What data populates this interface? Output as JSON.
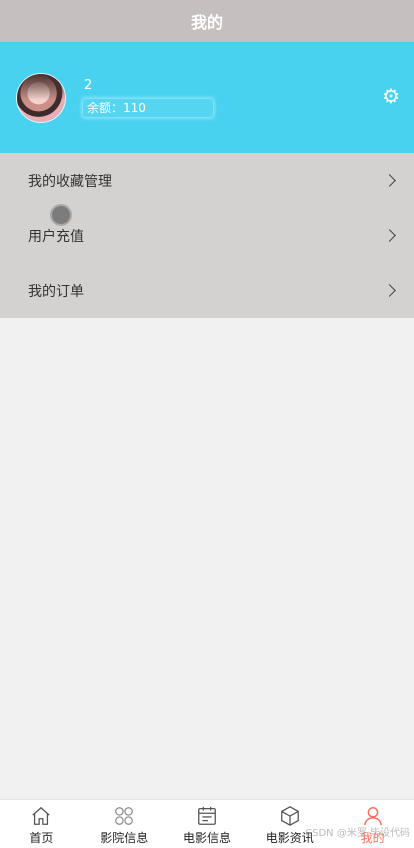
{
  "title": "我的",
  "profile": {
    "username": "2",
    "balance_label": "余额：",
    "balance_value": "110"
  },
  "icons": {
    "avatar": "user-avatar",
    "settings": "gear-icon"
  },
  "menu": [
    {
      "label": "我的收藏管理"
    },
    {
      "label": "用户充值"
    },
    {
      "label": "我的订单"
    }
  ],
  "nav": [
    {
      "label": "首页",
      "icon": "home-icon"
    },
    {
      "label": "影院信息",
      "icon": "clover-icon"
    },
    {
      "label": "电影信息",
      "icon": "calendar-icon"
    },
    {
      "label": "电影资讯",
      "icon": "box-icon"
    },
    {
      "label": "我的",
      "icon": "user-icon"
    }
  ],
  "watermark": "CSDN @米罗 毕设代码",
  "colors": {
    "header": "#c6bfbf",
    "profile_bg": "#48d2f0",
    "menu_bg": "#d4d2d0",
    "page_bg": "#f1f1f1",
    "nav_active": "#ff6b5a"
  }
}
